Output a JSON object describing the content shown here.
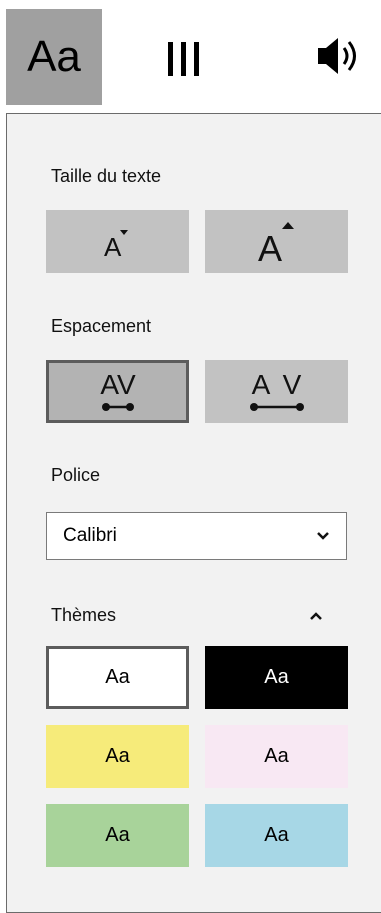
{
  "toolbar": {
    "text_tab_label": "Aa",
    "icons": {
      "columns": "columns-icon",
      "sound": "speaker-icon"
    }
  },
  "text_size": {
    "label": "Taille du texte",
    "glyph": "A"
  },
  "spacing": {
    "label": "Espacement",
    "narrow_glyph": "AV",
    "wide_glyph_a": "A",
    "wide_glyph_v": "V"
  },
  "font": {
    "label": "Police",
    "selected": "Calibri"
  },
  "themes": {
    "label": "Thèmes",
    "items": [
      {
        "label": "Aa",
        "background": "#ffffff",
        "color": "#000000",
        "selected": true
      },
      {
        "label": "Aa",
        "background": "#000000",
        "color": "#ffffff",
        "selected": false
      },
      {
        "label": "Aa",
        "background": "#f6eb7a",
        "color": "#000000",
        "selected": false
      },
      {
        "label": "Aa",
        "background": "#f8e8f3",
        "color": "#000000",
        "selected": false
      },
      {
        "label": "Aa",
        "background": "#a8d39a",
        "color": "#000000",
        "selected": false
      },
      {
        "label": "Aa",
        "background": "#a7d7e6",
        "color": "#000000",
        "selected": false
      }
    ]
  },
  "colors": {
    "panel_bg": "#f2f2f2",
    "button_bg": "#c2c2c2",
    "tab_active_bg": "#a0a0a0"
  }
}
